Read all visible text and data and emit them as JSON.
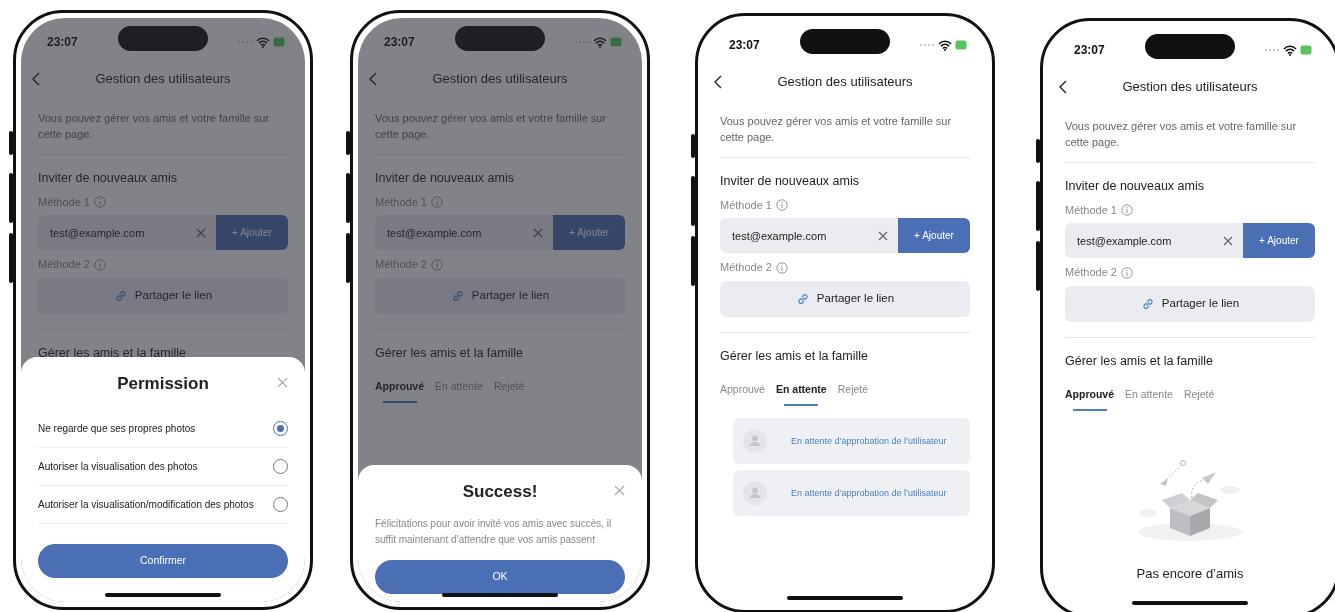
{
  "phones": [
    {
      "status_bar": {
        "time": "23:07"
      },
      "header": {
        "title": "Gestion des utilisateurs"
      },
      "intro": "Vous pouvez gérer vos amis et votre famille sur cette page.",
      "invite": {
        "heading": "Inviter de nouveaux amis",
        "method_1": "Méthode 1",
        "email_field": {
          "value": "test@example.com"
        },
        "add_button": "+ Ajouter",
        "method_2": "Méthode 2",
        "share_button": "Partager le lien"
      },
      "manage": {
        "heading": "Gérer les amis et la famille"
      },
      "dimmed": true,
      "sheet": {
        "kind": "permission",
        "title": "Permission",
        "options": [
          {
            "label": "Ne regarde que ses propres photos",
            "selected": true
          },
          {
            "label": "Autoriser la visualisation des photos",
            "selected": false
          },
          {
            "label": "Autoriser la visualisation/modification des photos",
            "selected": false
          }
        ],
        "button": "Confirmer"
      }
    },
    {
      "status_bar": {
        "time": "23:07"
      },
      "header": {
        "title": "Gestion des utilisateurs"
      },
      "intro": "Vous pouvez gérer vos amis et votre famille sur cette page.",
      "invite": {
        "heading": "Inviter de nouveaux amis",
        "method_1": "Méthode 1",
        "email_field": {
          "value": "test@example.com"
        },
        "add_button": "+ Ajouter",
        "method_2": "Méthode 2",
        "share_button": "Partager le lien"
      },
      "manage": {
        "heading": "Gérer les amis et la famille",
        "tabs": [
          {
            "label": "Approuvé",
            "selected": true
          },
          {
            "label": "En attente",
            "selected": false
          },
          {
            "label": "Rejeté",
            "selected": false
          }
        ]
      },
      "dimmed": true,
      "sheet": {
        "kind": "message",
        "title": "Success!",
        "message": "Félicitations pour avoir invité vos amis avec succès, il suffit maintenant d’attendre que vos amis passent",
        "button": "OK"
      }
    },
    {
      "status_bar": {
        "time": "23:07"
      },
      "header": {
        "title": "Gestion des utilisateurs"
      },
      "intro": "Vous pouvez gérer vos amis et votre famille sur cette page.",
      "invite": {
        "heading": "Inviter de nouveaux amis",
        "method_1": "Méthode 1",
        "email_field": {
          "value": "test@example.com"
        },
        "add_button": "+ Ajouter",
        "method_2": "Méthode 2",
        "share_button": "Partager le lien"
      },
      "manage": {
        "heading": "Gérer les amis et la famille",
        "tabs": [
          {
            "label": "Approuvé",
            "selected": false
          },
          {
            "label": "En attente",
            "selected": true
          },
          {
            "label": "Rejeté",
            "selected": false
          }
        ]
      },
      "dimmed": false,
      "pending": [
        {
          "label": "En attente d’approbation de l’utilisateur"
        },
        {
          "label": "En attente d’approbation de l’utilisateur"
        }
      ]
    },
    {
      "status_bar": {
        "time": "23:07"
      },
      "header": {
        "title": "Gestion des utilisateurs"
      },
      "intro": "Vous pouvez gérer vos amis et votre famille sur cette page.",
      "invite": {
        "heading": "Inviter de nouveaux amis",
        "method_1": "Méthode 1",
        "email_field": {
          "value": "test@example.com"
        },
        "add_button": "+ Ajouter",
        "method_2": "Méthode 2",
        "share_button": "Partager le lien"
      },
      "manage": {
        "heading": "Gérer les amis et la famille",
        "tabs": [
          {
            "label": "Approuvé",
            "selected": true
          },
          {
            "label": "En attente",
            "selected": false
          },
          {
            "label": "Rejeté",
            "selected": false
          }
        ]
      },
      "dimmed": false,
      "empty": {
        "label": "Pas encore d’amis"
      }
    }
  ]
}
